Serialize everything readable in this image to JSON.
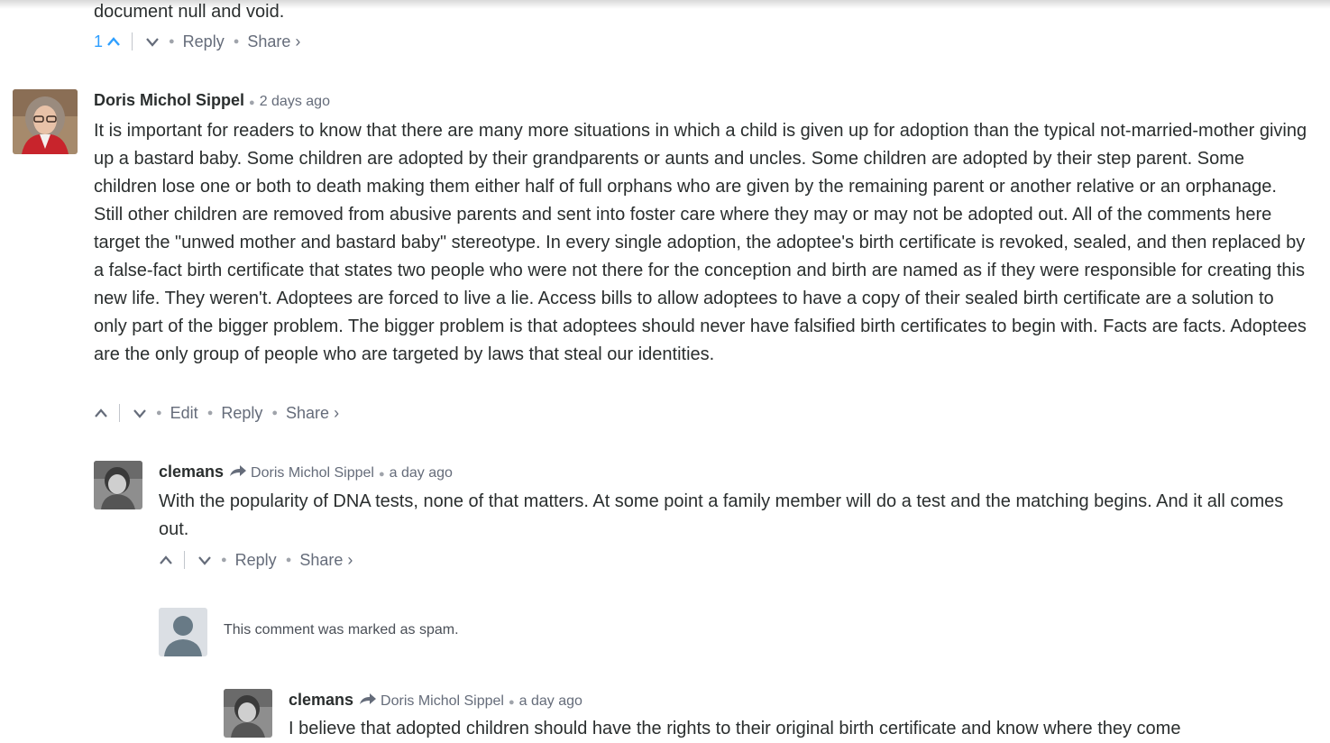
{
  "comment0": {
    "text_tail": "document null and void.",
    "upvotes": "1",
    "reply_label": "Reply",
    "share_label": "Share ›"
  },
  "comment1": {
    "author": "Doris Michol Sippel",
    "time": "2 days ago",
    "body": "It is important for readers to know that there are many more situations in which a child is given up for adoption than the typical not-married-mother giving up a bastard baby. Some children are adopted by their grandparents or aunts and uncles. Some children are adopted by their step parent. Some children lose one or both to death making them either half of full orphans who are given by the remaining parent or another relative or an orphanage. Still other children are removed from abusive parents and sent into foster care where they may or may not be adopted out. All of the comments here target the \"unwed mother and bastard baby\" stereotype. In every single adoption, the adoptee's birth certificate is revoked, sealed, and then replaced by a false-fact birth certificate that states two people who were not there for the conception and birth are named as if they were responsible for creating this new life. They weren't. Adoptees are forced to live a lie. Access bills to allow adoptees to have a copy of their sealed birth certificate are a solution to only part of the bigger problem. The bigger problem is that adoptees should never have falsified birth certificates to begin with. Facts are facts. Adoptees are the only group of people who are targeted by laws that steal our identities.",
    "edit_label": "Edit",
    "reply_label": "Reply",
    "share_label": "Share ›"
  },
  "comment2": {
    "author": "clemans",
    "in_reply_to": "Doris Michol Sippel",
    "time": "a day ago",
    "body": "With the popularity of DNA tests, none of that matters. At some point a family member will do a test and the matching begins. And it all comes out.",
    "reply_label": "Reply",
    "share_label": "Share ›"
  },
  "comment3": {
    "spam_notice": "This comment was marked as spam."
  },
  "comment4": {
    "author": "clemans",
    "in_reply_to": "Doris Michol Sippel",
    "time": "a day ago",
    "body_partial": "I believe that adopted children should have the rights to their original birth certificate and know where they come"
  },
  "colors": {
    "text": "#2a2e2e",
    "meta": "#656c7a",
    "upvote_active": "#2e9fff",
    "separator": "#c2c6cc"
  }
}
